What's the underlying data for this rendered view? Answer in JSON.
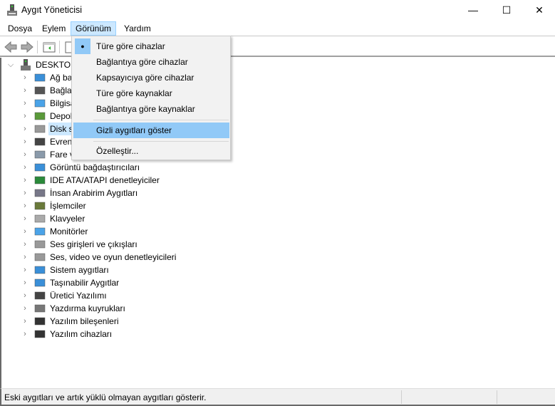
{
  "window": {
    "title": "Aygıt Yöneticisi",
    "minimize": "—",
    "maximize": "☐",
    "close": "✕"
  },
  "menu": {
    "items": [
      {
        "label": "Dosya"
      },
      {
        "label": "Eylem"
      },
      {
        "label": "Görünüm"
      },
      {
        "label": "Yardım"
      }
    ]
  },
  "view_menu": {
    "items": [
      {
        "label": "Türe göre cihazlar",
        "checked": true
      },
      {
        "label": "Bağlantıya göre cihazlar"
      },
      {
        "label": "Kapsayıcıya göre cihazlar"
      },
      {
        "label": "Türe göre kaynaklar"
      },
      {
        "label": "Bağlantıya göre kaynaklar"
      },
      {
        "label": "Gizli aygıtları göster"
      },
      {
        "label": "Özelleştir..."
      }
    ],
    "check_glyph": "●"
  },
  "tree": {
    "root": "DESKTOP-",
    "items": [
      {
        "label": "Ağ bağ",
        "icon": "network-adapter-icon"
      },
      {
        "label": "Bağlar",
        "icon": "port-icon"
      },
      {
        "label": "Bilgisa",
        "icon": "computer-icon"
      },
      {
        "label": "Depola",
        "icon": "storage-controller-icon"
      },
      {
        "label": "Disk sü",
        "icon": "disk-drive-icon"
      },
      {
        "label": "Evrens",
        "icon": "usb-icon"
      },
      {
        "label": "Fare ve",
        "icon": "mouse-icon"
      },
      {
        "label": "Görüntü bağdaştırıcıları",
        "icon": "display-adapter-icon"
      },
      {
        "label": "IDE ATA/ATAPI denetleyiciler",
        "icon": "ide-controller-icon"
      },
      {
        "label": "İnsan Arabirim Aygıtları",
        "icon": "hid-icon"
      },
      {
        "label": "İşlemciler",
        "icon": "processor-icon"
      },
      {
        "label": "Klavyeler",
        "icon": "keyboard-icon"
      },
      {
        "label": "Monitörler",
        "icon": "monitor-icon"
      },
      {
        "label": "Ses girişleri ve çıkışları",
        "icon": "speaker-icon"
      },
      {
        "label": "Ses, video ve oyun denetleyicileri",
        "icon": "speaker-icon"
      },
      {
        "label": "Sistem aygıtları",
        "icon": "system-devices-icon"
      },
      {
        "label": "Taşınabilir Aygıtlar",
        "icon": "portable-device-icon"
      },
      {
        "label": "Üretici Yazılımı",
        "icon": "firmware-icon"
      },
      {
        "label": "Yazdırma kuyrukları",
        "icon": "printer-icon"
      },
      {
        "label": "Yazılım bileşenleri",
        "icon": "software-component-icon"
      },
      {
        "label": "Yazılım cihazları",
        "icon": "software-device-icon"
      }
    ]
  },
  "status": {
    "text": "Eski aygıtları ve artık yüklü olmayan aygıtları gösterir."
  },
  "colors": {
    "menu_highlight": "#91c9f7",
    "menu_open": "#cce8ff",
    "selection": "#cce8ff"
  }
}
